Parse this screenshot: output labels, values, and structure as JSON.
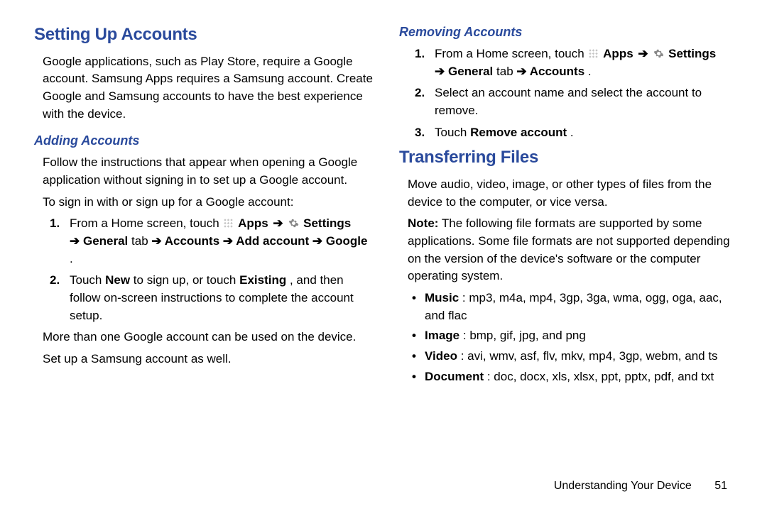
{
  "left": {
    "h1": "Setting Up Accounts",
    "intro": "Google applications, such as Play Store, require a Google account. Samsung Apps requires a Samsung account. Create Google and Samsung accounts to have the best experience with the device.",
    "adding": {
      "h2": "Adding Accounts",
      "p1": "Follow the instructions that appear when opening a Google application without signing in to set up a Google account.",
      "p2": "To sign in with or sign up for a Google account:",
      "step1": {
        "pre": "From a Home screen, touch ",
        "apps": "Apps",
        "settings": "Settings",
        "line2a": "➔ General",
        "line2b": " tab ",
        "line2c": "➔ Accounts ➔ Add account ➔ Google",
        "dot": "."
      },
      "step2a": "Touch ",
      "step2b": "New",
      "step2c": " to sign up, or touch ",
      "step2d": "Existing",
      "step2e": ", and then follow on-screen instructions to complete the account setup.",
      "p3": "More than one Google account can be used on the device.",
      "p4": "Set up a Samsung account as well."
    }
  },
  "right": {
    "removing": {
      "h2": "Removing Accounts",
      "step1": {
        "pre": "From a Home screen, touch ",
        "apps": "Apps",
        "settings": "Settings",
        "line2a": "➔ General",
        "line2b": " tab ",
        "line2c": "➔ Accounts",
        "dot": "."
      },
      "step2": "Select an account name and select the account to remove.",
      "step3a": "Touch ",
      "step3b": "Remove account",
      "step3c": "."
    },
    "transfer": {
      "h1": "Transferring Files",
      "p1": "Move audio, video, image, or other types of files from the device to the computer, or vice versa.",
      "noteLabel": "Note:",
      "note": " The following file formats are supported by some applications. Some file formats are not supported depending on the version of the device's software or the computer operating system.",
      "musicL": "Music",
      "music": ": mp3, m4a, mp4, 3gp, 3ga, wma, ogg, oga, aac, and flac",
      "imageL": "Image",
      "image": ": bmp, gif, jpg, and png",
      "videoL": "Video",
      "video": ": avi, wmv, asf, flv, mkv, mp4, 3gp, webm, and ts",
      "docL": "Document",
      "doc": ": doc, docx, xls, xlsx, ppt, pptx, pdf, and txt"
    }
  },
  "footer": {
    "section": "Understanding Your Device",
    "page": "51"
  },
  "glyph": {
    "arrow": "➔",
    "bullet": "•"
  }
}
